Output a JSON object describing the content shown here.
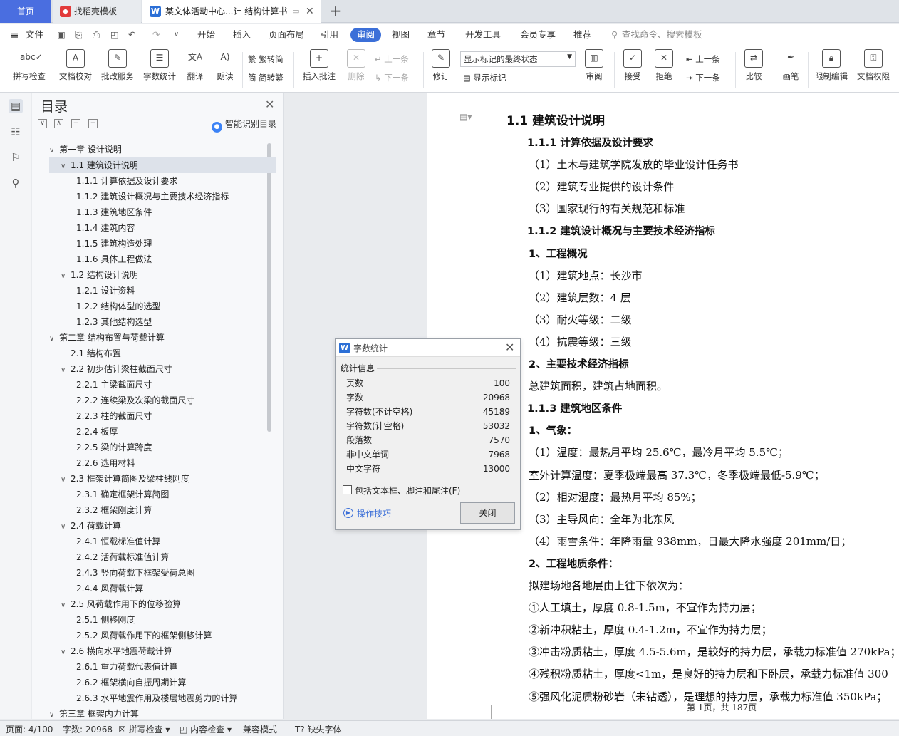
{
  "tabs": {
    "home": "首页",
    "template": "找稻壳模板",
    "doc": "某文体活动中心...计 结构计算书"
  },
  "menu": {
    "file": "文件",
    "items": [
      "开始",
      "插入",
      "页面布局",
      "引用",
      "审阅",
      "视图",
      "章节",
      "开发工具",
      "会员专享",
      "推荐"
    ],
    "active": "审阅",
    "search": "查找命令、搜索模板"
  },
  "ribbon": {
    "spell": "拼写检查",
    "proof": "文档校对",
    "annotate": "批改服务",
    "count": "字数统计",
    "translate": "翻译",
    "read": "朗读",
    "trad": "繁转简",
    "simp": "简转繁",
    "insert_comment": "插入批注",
    "delete": "删除",
    "prev": "上一条",
    "next": "下一条",
    "revise": "修订",
    "markup_select": "显示标记的最终状态",
    "show_markup": "显示标记",
    "review": "审阅",
    "accept": "接受",
    "reject": "拒绝",
    "prev2": "上一条",
    "next2": "下一条",
    "compare": "比较",
    "pen": "画笔",
    "restrict": "限制编辑",
    "rights": "文档权限"
  },
  "toc": {
    "title": "目录",
    "smart": "智能识别目录",
    "items": [
      {
        "text": "第一章  设计说明",
        "level": 0,
        "caret": "∨"
      },
      {
        "text": "1.1  建筑设计说明",
        "level": 1,
        "caret": "∨",
        "selected": true
      },
      {
        "text": "1.1.1  计算依据及设计要求",
        "level": 2
      },
      {
        "text": "1.1.2  建筑设计概况与主要技术经济指标",
        "level": 2
      },
      {
        "text": "1.1.3  建筑地区条件",
        "level": 2
      },
      {
        "text": "1.1.4  建筑内容",
        "level": 2
      },
      {
        "text": "1.1.5  建筑构造处理",
        "level": 2
      },
      {
        "text": "1.1.6  具体工程做法",
        "level": 2
      },
      {
        "text": "1.2  结构设计说明",
        "level": 1,
        "caret": "∨"
      },
      {
        "text": "1.2.1  设计资料",
        "level": 2
      },
      {
        "text": "1.2.2  结构体型的选型",
        "level": 2
      },
      {
        "text": "1.2.3  其他结构选型",
        "level": 2
      },
      {
        "text": "第二章  结构布置与荷载计算",
        "level": 0,
        "caret": "∨"
      },
      {
        "text": "2.1  结构布置",
        "level": 1
      },
      {
        "text": "2.2  初步估计梁柱截面尺寸",
        "level": 1,
        "caret": "∨"
      },
      {
        "text": "2.2.1  主梁截面尺寸",
        "level": 2
      },
      {
        "text": "2.2.2  连续梁及次梁的截面尺寸",
        "level": 2
      },
      {
        "text": "2.2.3  柱的截面尺寸",
        "level": 2
      },
      {
        "text": "2.2.4  板厚",
        "level": 2
      },
      {
        "text": "2.2.5  梁的计算跨度",
        "level": 2
      },
      {
        "text": "2.2.6  选用材料",
        "level": 2
      },
      {
        "text": "2.3  框架计算简图及梁柱线刚度",
        "level": 1,
        "caret": "∨"
      },
      {
        "text": "2.3.1  确定框架计算简图",
        "level": 2
      },
      {
        "text": "2.3.2  框架刚度计算",
        "level": 2
      },
      {
        "text": "2.4  荷载计算",
        "level": 1,
        "caret": "∨"
      },
      {
        "text": "2.4.1  恒载标准值计算",
        "level": 2
      },
      {
        "text": "2.4.2  活荷载标准值计算",
        "level": 2
      },
      {
        "text": "2.4.3  竖向荷载下框架受荷总图",
        "level": 2
      },
      {
        "text": "2.4.4  风荷载计算",
        "level": 2
      },
      {
        "text": "2.5  风荷载作用下的位移验算",
        "level": 1,
        "caret": "∨"
      },
      {
        "text": "2.5.1  侧移刚度",
        "level": 2
      },
      {
        "text": "2.5.2  风荷载作用下的框架侧移计算",
        "level": 2
      },
      {
        "text": "2.6  横向水平地震荷载计算",
        "level": 1,
        "caret": "∨"
      },
      {
        "text": "2.6.1  重力荷载代表值计算",
        "level": 2
      },
      {
        "text": "2.6.2  框架横向自振周期计算",
        "level": 2
      },
      {
        "text": "2.6.3 水平地震作用及楼层地震剪力的计算",
        "level": 2
      },
      {
        "text": "第三章  框架内力计算",
        "level": 0,
        "caret": "∨"
      }
    ]
  },
  "doc": {
    "lines": [
      {
        "t": "1.1  建筑设计说明",
        "h": true,
        "big": true
      },
      {
        "t": "1.1.1  计算依据及设计要求",
        "h": true
      },
      {
        "t": "（1）土木与建筑学院发放的毕业设计任务书"
      },
      {
        "t": "（2）建筑专业提供的设计条件"
      },
      {
        "t": "（3）国家现行的有关规范和标准"
      },
      {
        "t": "1.1.2  建筑设计概况与主要技术经济指标",
        "h": true
      },
      {
        "t": "1、工程概况",
        "h": true
      },
      {
        "t": "（1）建筑地点：长沙市"
      },
      {
        "t": "（2）建筑层数：4 层"
      },
      {
        "t": "（3）耐火等级：二级"
      },
      {
        "t": "（4）抗震等级：三级"
      },
      {
        "t": "2、主要技术经济指标",
        "h": true
      },
      {
        "t": "总建筑面积，建筑占地面积。"
      },
      {
        "t": "1.1.3  建筑地区条件",
        "h": true
      },
      {
        "t": "1、气象：",
        "h": true
      },
      {
        "t": "（1）温度：最热月平均 25.6℃，最冷月平均 5.5℃；"
      },
      {
        "t": "室外计算温度：夏季极端最高 37.3℃，冬季极端最低-5.9℃；"
      },
      {
        "t": "（2）相对湿度：最热月平均 85%；"
      },
      {
        "t": "（3）主导风向：全年为北东风"
      },
      {
        "t": "（4）雨雪条件：年降雨量 938mm，日最大降水强度 201mm/日；"
      },
      {
        "t": "2、工程地质条件：",
        "h": true
      },
      {
        "t": "拟建场地各地层由上往下依次为："
      },
      {
        "t": "①人工填土，厚度 0.8-1.5m，不宜作为持力层；"
      },
      {
        "t": "②新冲积粘土，厚度 0.4-1.2m，不宜作为持力层；"
      },
      {
        "t": "③冲击粉质粘土，厚度 4.5-5.6m，是较好的持力层，承载力标准值 270kPa；"
      },
      {
        "t": "④残积粉质粘土，厚度<1m，是良好的持力层和下卧层，承载力标准值 300"
      },
      {
        "t": "⑤强风化泥质粉砂岩（未钻透），是理想的持力层，承载力标准值 350kPa；"
      }
    ],
    "page_footer": "第 1页，共 187页"
  },
  "dialog": {
    "title": "字数统计",
    "section": "统计信息",
    "rows": [
      {
        "label": "页数",
        "value": "100"
      },
      {
        "label": "字数",
        "value": "20968"
      },
      {
        "label": "字符数(不计空格)",
        "value": "45189"
      },
      {
        "label": "字符数(计空格)",
        "value": "53032"
      },
      {
        "label": "段落数",
        "value": "7570"
      },
      {
        "label": "非中文单词",
        "value": "7968"
      },
      {
        "label": "中文字符",
        "value": "13000"
      }
    ],
    "checkbox": "包括文本框、脚注和尾注(F)",
    "tips": "操作技巧",
    "close": "关闭"
  },
  "status": {
    "page": "页面: 4/100",
    "words": "字数: 20968",
    "spell": "拼写检查",
    "content": "内容检查",
    "compat": "兼容模式",
    "font": "缺失字体"
  }
}
